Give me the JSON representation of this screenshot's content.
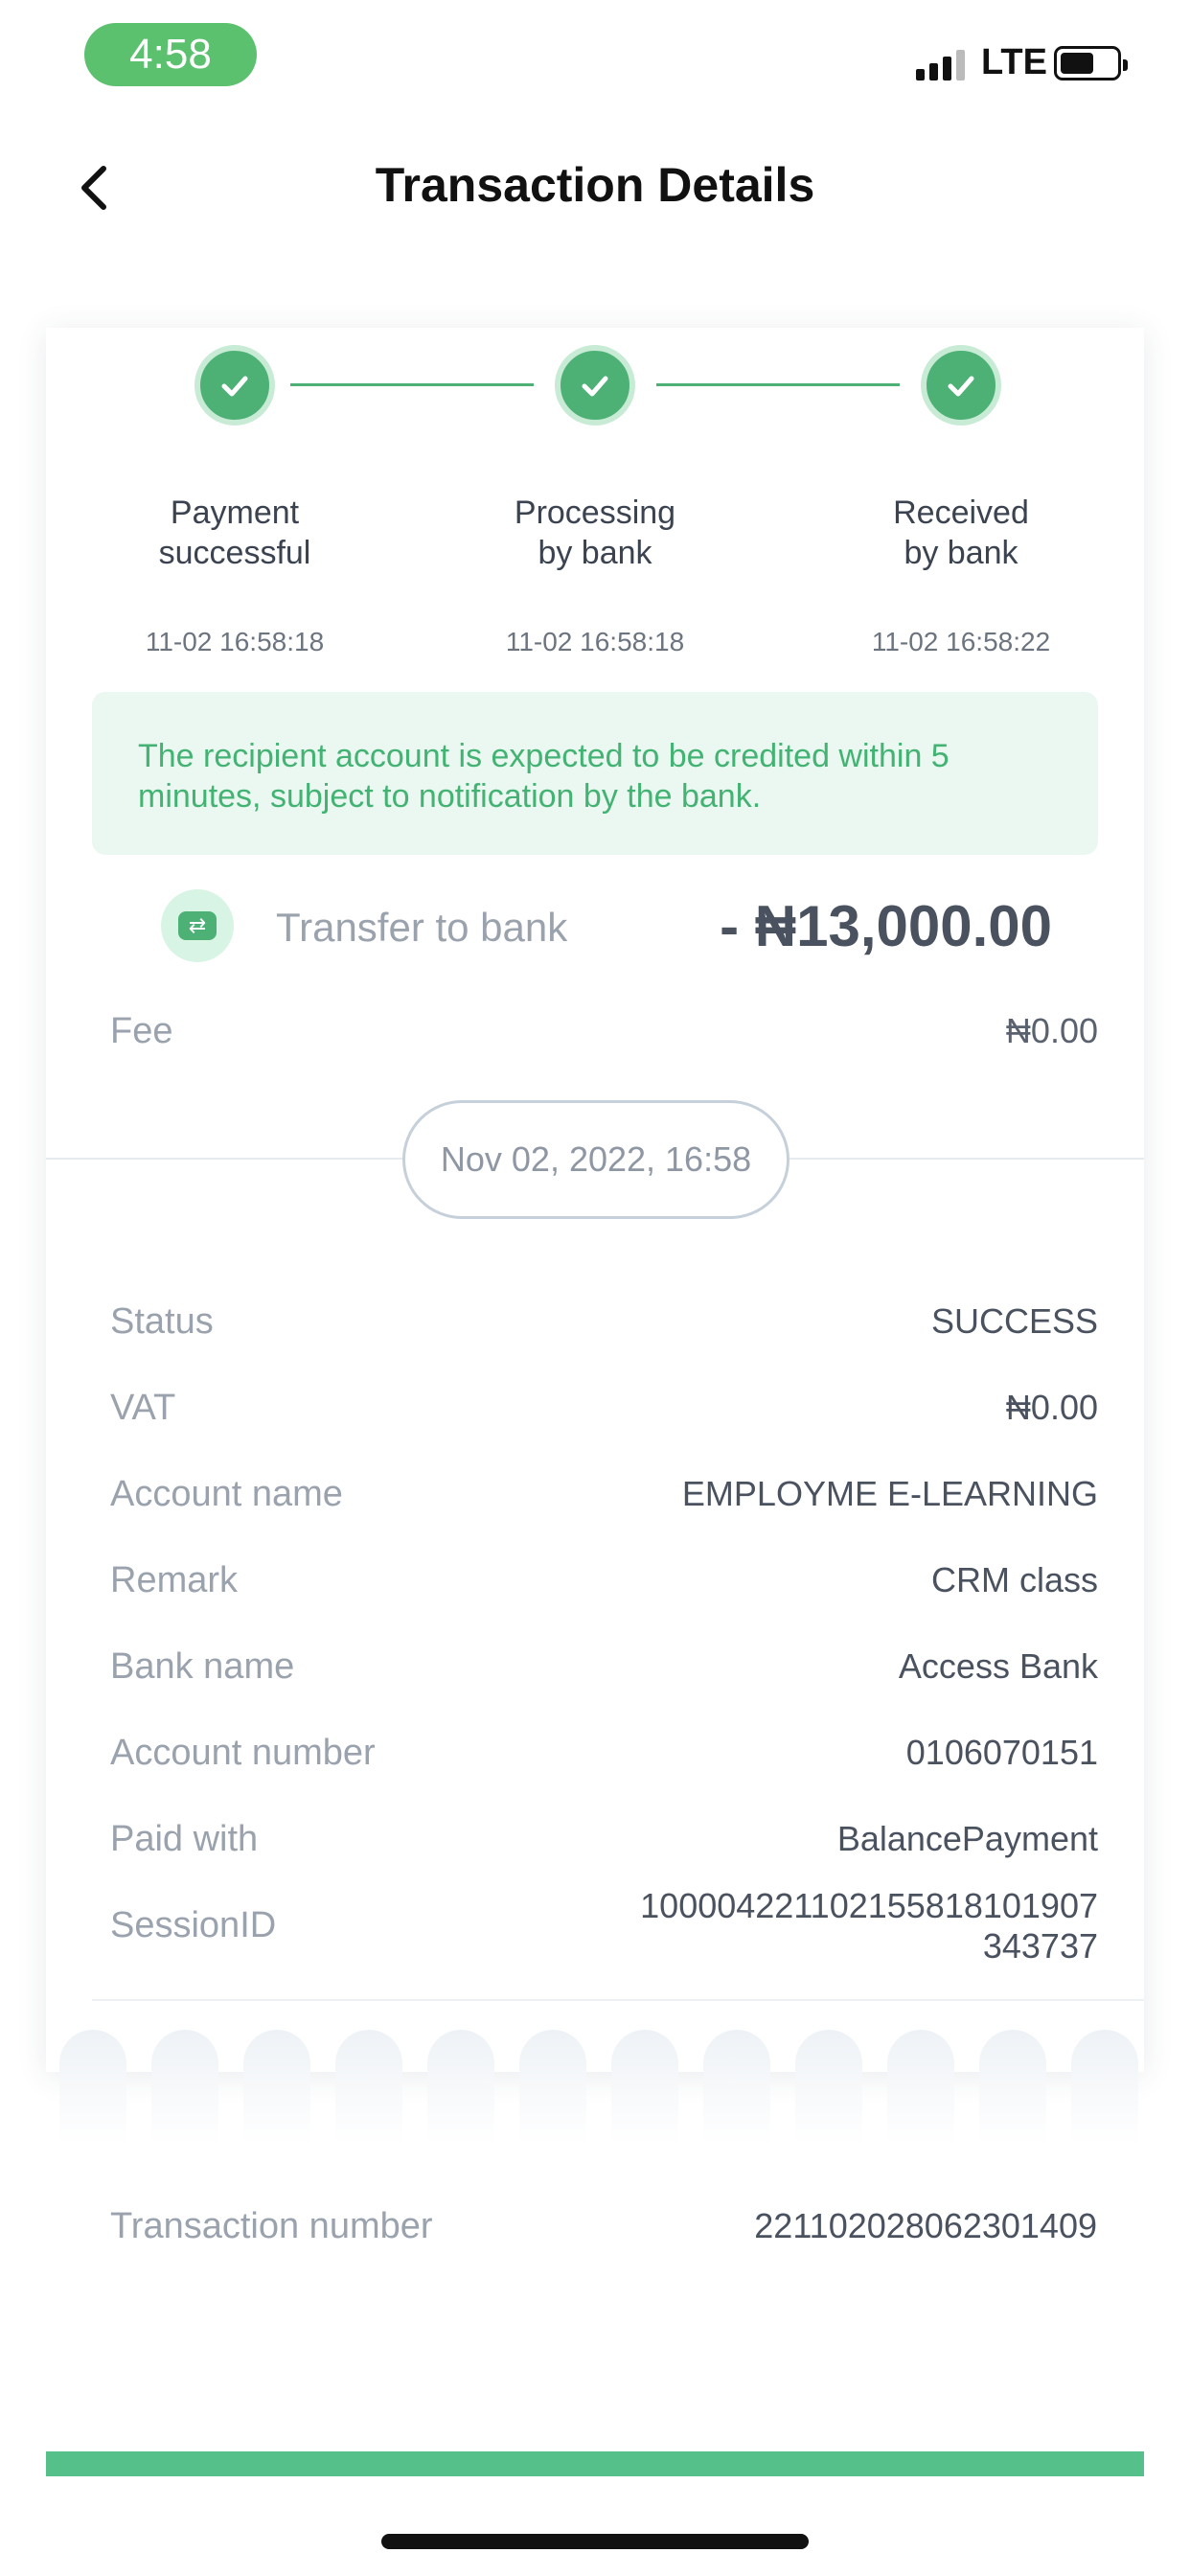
{
  "status_bar": {
    "time": "4:58",
    "network": "LTE"
  },
  "header": {
    "title": "Transaction Details",
    "back_icon": "chevron-left-icon"
  },
  "steps": [
    {
      "label_line1": "Payment",
      "label_line2": "successful",
      "time": "11-02 16:58:18"
    },
    {
      "label_line1": "Processing",
      "label_line2": "by bank",
      "time": "11-02 16:58:18"
    },
    {
      "label_line1": "Received",
      "label_line2": "by bank",
      "time": "11-02 16:58:22"
    }
  ],
  "notice": "The recipient account is expected to be credited within 5 minutes, subject to notification by the bank.",
  "transfer": {
    "label": "Transfer to bank",
    "amount": "- ₦13,000.00",
    "icon": "transfer-icon"
  },
  "fee": {
    "label": "Fee",
    "value": "₦0.00"
  },
  "date": "Nov 02, 2022, 16:58",
  "details": [
    {
      "label": "Status",
      "value": "SUCCESS"
    },
    {
      "label": "VAT",
      "value": "₦0.00"
    },
    {
      "label": "Account name",
      "value": "EMPLOYME E-LEARNING"
    },
    {
      "label": "Remark",
      "value": "CRM class"
    },
    {
      "label": "Bank name",
      "value": "Access Bank"
    },
    {
      "label": "Account number",
      "value": "0106070151"
    },
    {
      "label": "Paid with",
      "value": "BalancePayment"
    },
    {
      "label": "SessionID",
      "value_line1": "100004221102155818101907",
      "value_line2": "343737"
    }
  ],
  "transaction": {
    "label": "Transaction number",
    "value": "221102028062301409"
  },
  "colors": {
    "accent": "#4db175",
    "notice_bg": "#ebf7f1",
    "notice_text": "#43b373",
    "bottom_bar": "#56c08a"
  }
}
